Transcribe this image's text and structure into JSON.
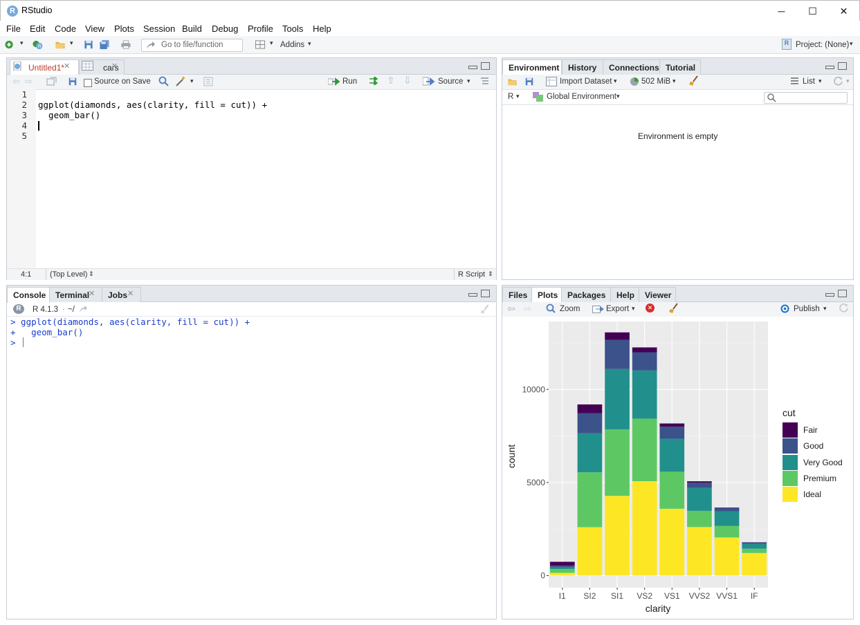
{
  "window": {
    "title": "RStudio",
    "minimize": "─",
    "maximize": "☐",
    "close": "✕"
  },
  "menu": [
    "File",
    "Edit",
    "Code",
    "View",
    "Plots",
    "Session",
    "Build",
    "Debug",
    "Profile",
    "Tools",
    "Help"
  ],
  "toolbar": {
    "goto_placeholder": "Go to file/function",
    "addins": "Addins",
    "project": "Project: (None)"
  },
  "editor": {
    "tabs": [
      {
        "label": "Untitled1*",
        "modified": true
      },
      {
        "label": "cars"
      }
    ],
    "source_on_save": "Source on Save",
    "run": "Run",
    "source": "Source",
    "line_numbers": [
      "1",
      "2",
      "3",
      "4",
      "5"
    ],
    "lines": [
      "",
      "ggplot(diamonds, aes(clarity, fill = cut)) +",
      "  geom_bar()",
      "",
      ""
    ],
    "status_position": "4:1",
    "status_scope": "(Top Level)",
    "status_type": "R Script"
  },
  "environment": {
    "tabs": [
      "Environment",
      "History",
      "Connections",
      "Tutorial"
    ],
    "import_dataset": "Import Dataset",
    "memory": "502 MiB",
    "view_mode": "List",
    "language": "R",
    "scope": "Global Environment",
    "empty_message": "Environment is empty"
  },
  "console": {
    "tabs": [
      "Console",
      "Terminal",
      "Jobs"
    ],
    "version": "R 4.1.3",
    "path": "~/",
    "lines": [
      "> ggplot(diamonds, aes(clarity, fill = cut)) +",
      "+   geom_bar()",
      "> "
    ]
  },
  "files": {
    "tabs": [
      "Files",
      "Plots",
      "Packages",
      "Help",
      "Viewer"
    ],
    "zoom": "Zoom",
    "export": "Export",
    "publish": "Publish"
  },
  "colors": {
    "fair": "#440154",
    "good": "#3b528b",
    "very_good": "#21908c",
    "premium": "#5dc863",
    "ideal": "#fde725",
    "panel": "#ebebeb",
    "console_blue": "#1a3ccc",
    "modified_tab": "#c0392b"
  },
  "chart_data": {
    "type": "bar",
    "stacked": true,
    "categories": [
      "I1",
      "SI2",
      "SI1",
      "VS2",
      "VS1",
      "VVS2",
      "VVS1",
      "IF"
    ],
    "series": [
      {
        "name": "Fair",
        "color": "#440154",
        "values": [
          210,
          466,
          408,
          261,
          170,
          69,
          17,
          9
        ]
      },
      {
        "name": "Good",
        "color": "#3b528b",
        "values": [
          96,
          1081,
          1560,
          978,
          648,
          286,
          186,
          71
        ]
      },
      {
        "name": "Very Good",
        "color": "#21908c",
        "values": [
          84,
          2100,
          3240,
          2591,
          1775,
          1235,
          789,
          268
        ]
      },
      {
        "name": "Premium",
        "color": "#5dc863",
        "values": [
          205,
          2949,
          3575,
          3357,
          1989,
          870,
          616,
          230
        ]
      },
      {
        "name": "Ideal",
        "color": "#fde725",
        "values": [
          146,
          2598,
          4282,
          5071,
          3589,
          2606,
          2047,
          1212
        ]
      }
    ],
    "xlabel": "clarity",
    "ylabel": "count",
    "yticks": [
      0,
      5000,
      10000
    ],
    "ylim": [
      -650,
      13650
    ],
    "legend_title": "cut",
    "legend_position": "right",
    "grid": true
  }
}
